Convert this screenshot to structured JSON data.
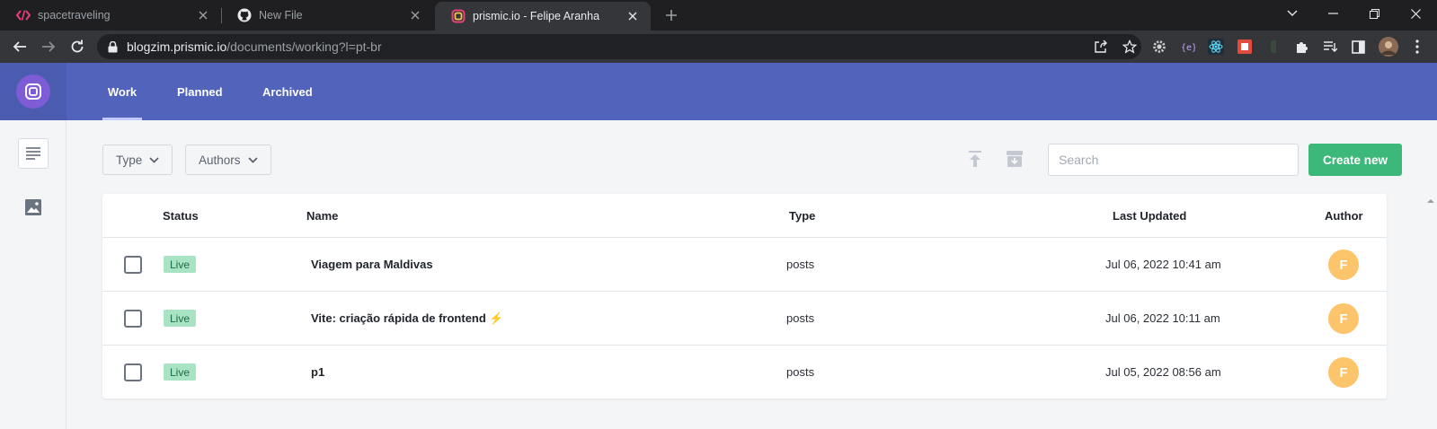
{
  "browser": {
    "tabs": [
      {
        "title": "spacetraveling",
        "icon": "code-icon"
      },
      {
        "title": "New File",
        "icon": "github-icon"
      },
      {
        "title": "prismic.io - Felipe Aranha",
        "icon": "prismic-icon"
      }
    ],
    "url_host": "blogzim.prismic.io",
    "url_path": "/documents/working?l=pt-br"
  },
  "header": {
    "nav": [
      "Work",
      "Planned",
      "Archived"
    ],
    "active": "Work",
    "brand_color": "#5163ba"
  },
  "toolbar": {
    "type_filter": "Type",
    "authors_filter": "Authors",
    "search_placeholder": "Search",
    "create_label": "Create new",
    "create_color": "#3cb87a"
  },
  "table": {
    "headers": {
      "status": "Status",
      "name": "Name",
      "type": "Type",
      "updated": "Last Updated",
      "author": "Author"
    },
    "rows": [
      {
        "status": "Live",
        "name": "Viagem para Maldivas",
        "type": "posts",
        "updated": "Jul 06, 2022 10:41 am",
        "author": "F"
      },
      {
        "status": "Live",
        "name": "Vite: criação rápida de frontend ⚡",
        "type": "posts",
        "updated": "Jul 06, 2022 10:11 am",
        "author": "F"
      },
      {
        "status": "Live",
        "name": "p1",
        "type": "posts",
        "updated": "Jul 05, 2022 08:56 am",
        "author": "F"
      }
    ]
  }
}
